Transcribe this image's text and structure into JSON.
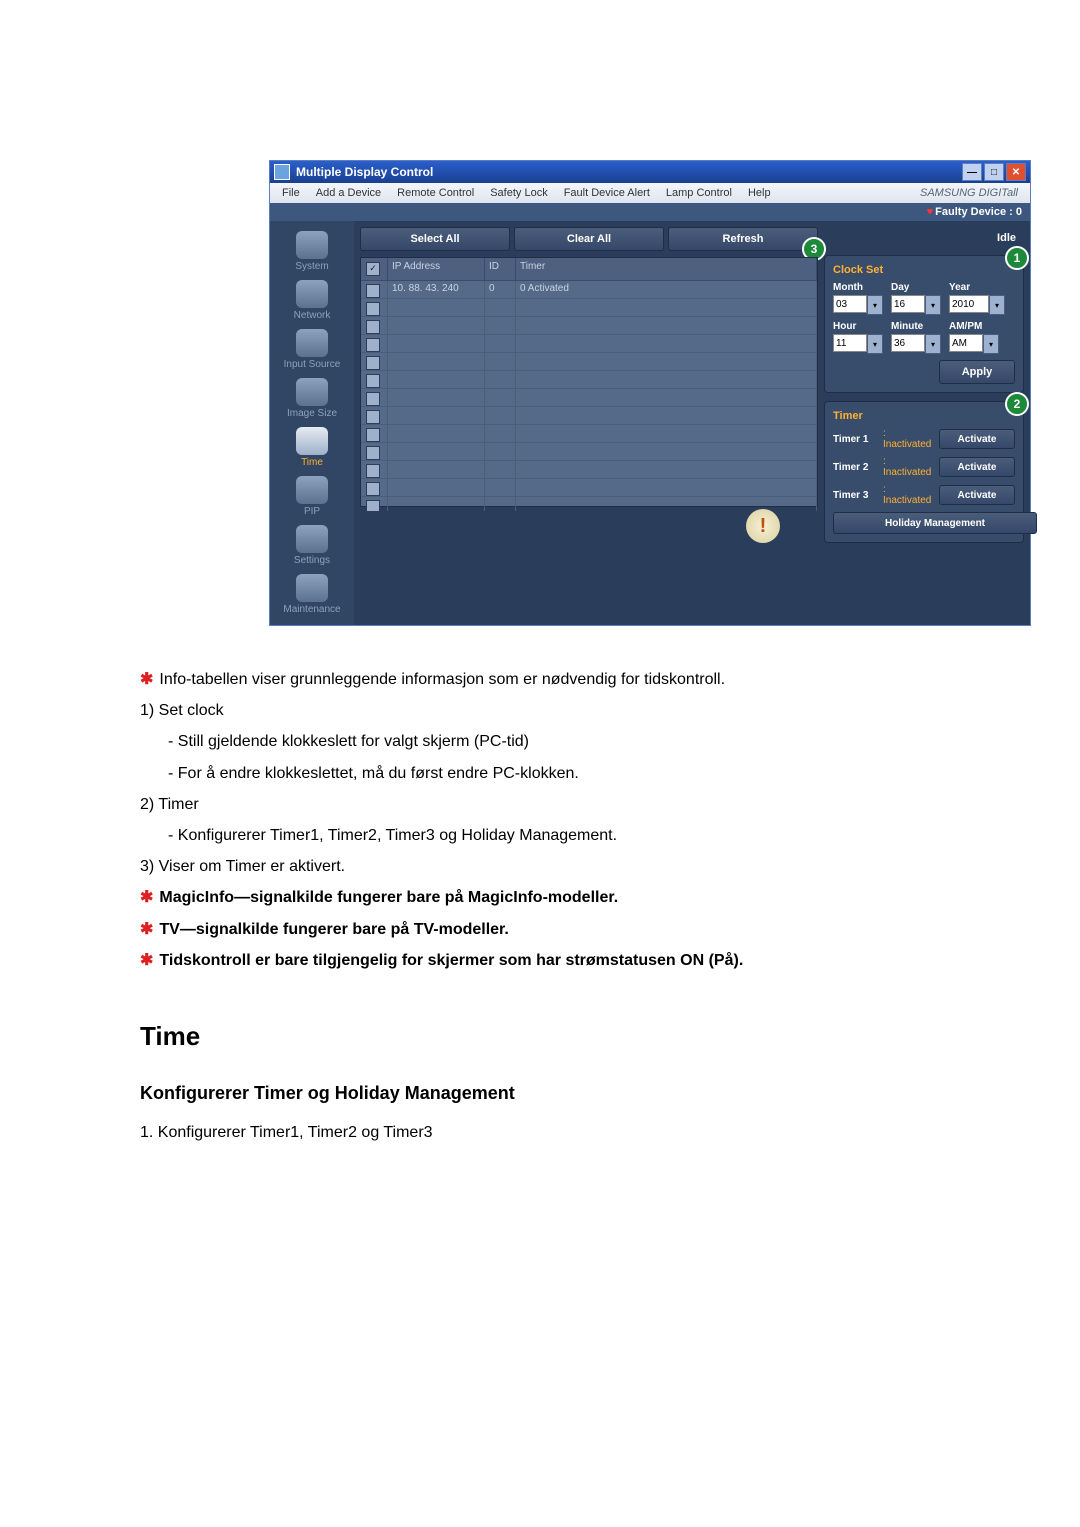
{
  "app": {
    "title": "Multiple Display Control",
    "menu": [
      "File",
      "Add a Device",
      "Remote Control",
      "Safety Lock",
      "Fault Device Alert",
      "Lamp Control",
      "Help"
    ],
    "brand": "SAMSUNG DIGITall",
    "faulty_label": "Faulty Device : 0",
    "toolbar": {
      "select_all": "Select All",
      "clear_all": "Clear All",
      "refresh": "Refresh"
    },
    "status": "Idle",
    "table": {
      "headers": [
        "",
        "IP Address",
        "ID",
        "Timer"
      ],
      "row": {
        "ip": "10. 88. 43. 240",
        "id": "0",
        "timer": "0 Activated"
      }
    },
    "clock": {
      "title": "Clock Set",
      "labels": {
        "month": "Month",
        "day": "Day",
        "year": "Year",
        "hour": "Hour",
        "minute": "Minute",
        "ampm": "AM/PM"
      },
      "values": {
        "month": "03",
        "day": "16",
        "year": "2010",
        "hour": "11",
        "minute": "36",
        "ampm": "AM"
      },
      "apply": "Apply"
    },
    "timer": {
      "title": "Timer",
      "rows": [
        {
          "name": "Timer 1",
          "status": ": Inactivated",
          "btn": "Activate"
        },
        {
          "name": "Timer 2",
          "status": ": Inactivated",
          "btn": "Activate"
        },
        {
          "name": "Timer 3",
          "status": ": Inactivated",
          "btn": "Activate"
        }
      ],
      "holiday": "Holiday Management"
    },
    "sidebar": [
      "System",
      "Network",
      "Input Source",
      "Image Size",
      "Time",
      "PIP",
      "Settings",
      "Maintenance"
    ]
  },
  "doc": {
    "p1": "Info-tabellen viser grunnleggende informasjon som er nødvendig for tidskontroll.",
    "i1": "1)  Set clock",
    "i1a": "- Still gjeldende klokkeslett for valgt skjerm (PC-tid)",
    "i1b": "- For å endre klokkeslettet, må du først endre PC-klokken.",
    "i2": "2)  Timer",
    "i2a": "- Konfigurerer Timer1, Timer2, Timer3 og Holiday Management.",
    "i3": "3)  Viser om Timer er aktivert.",
    "n1": "MagicInfo—signalkilde fungerer bare på MagicInfo-modeller.",
    "n2": "TV—signalkilde fungerer bare på TV-modeller.",
    "n3": "Tidskontroll er bare tilgjengelig for skjermer som har strømstatusen ON (På).",
    "h2": "Time",
    "h3": "Konfigurerer Timer og Holiday Management",
    "s1": "1. Konfigurerer Timer1, Timer2 og Timer3"
  }
}
